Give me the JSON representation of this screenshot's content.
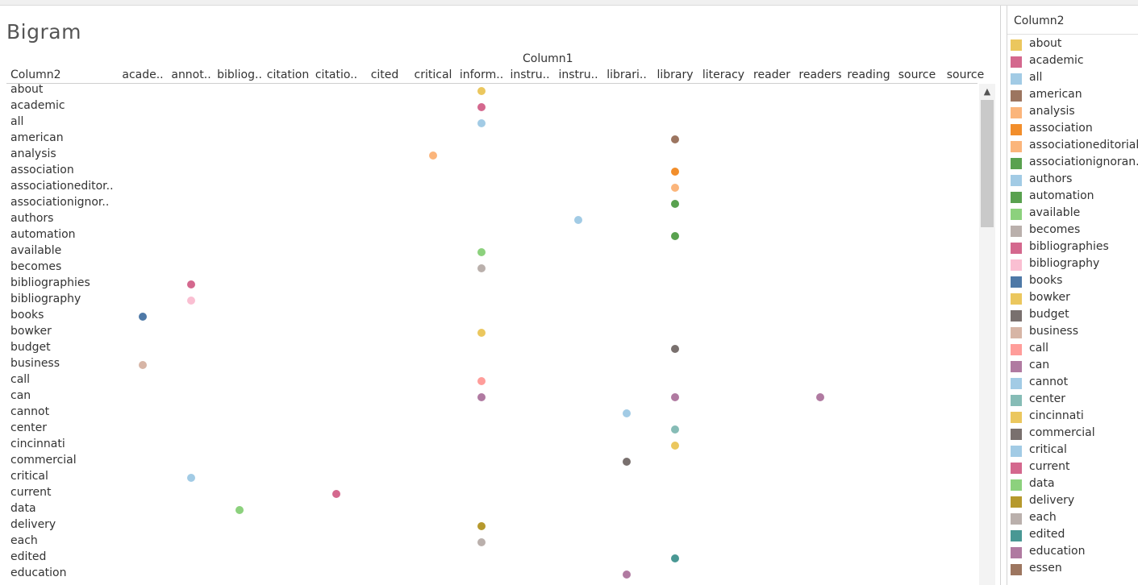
{
  "title": "Bigram",
  "legend": {
    "title": "Column2",
    "items": [
      {
        "label": "about",
        "color": "#ebc75e"
      },
      {
        "label": "academic",
        "color": "#d4688e"
      },
      {
        "label": "all",
        "color": "#a2cbe5"
      },
      {
        "label": "american",
        "color": "#9c7560"
      },
      {
        "label": "analysis",
        "color": "#fbb57b"
      },
      {
        "label": "association",
        "color": "#f28e2b"
      },
      {
        "label": "associationeditorial",
        "color": "#fbb57b"
      },
      {
        "label": "associationignoran..",
        "color": "#59a14f"
      },
      {
        "label": "authors",
        "color": "#a2cbe5"
      },
      {
        "label": "automation",
        "color": "#59a14f"
      },
      {
        "label": "available",
        "color": "#8cd17d"
      },
      {
        "label": "becomes",
        "color": "#bab0ac"
      },
      {
        "label": "bibliographies",
        "color": "#d4688e"
      },
      {
        "label": "bibliography",
        "color": "#fabfd2"
      },
      {
        "label": "books",
        "color": "#4e79a7"
      },
      {
        "label": "bowker",
        "color": "#ebc75e"
      },
      {
        "label": "budget",
        "color": "#79706e"
      },
      {
        "label": "business",
        "color": "#d7b5a6"
      },
      {
        "label": "call",
        "color": "#ff9d9a"
      },
      {
        "label": "can",
        "color": "#b07aa1"
      },
      {
        "label": "cannot",
        "color": "#a2cbe5"
      },
      {
        "label": "center",
        "color": "#86bcb6"
      },
      {
        "label": "cincinnati",
        "color": "#ebc75e"
      },
      {
        "label": "commercial",
        "color": "#79706e"
      },
      {
        "label": "critical",
        "color": "#a2cbe5"
      },
      {
        "label": "current",
        "color": "#d4688e"
      },
      {
        "label": "data",
        "color": "#8cd17d"
      },
      {
        "label": "delivery",
        "color": "#b6992d"
      },
      {
        "label": "each",
        "color": "#bab0ac"
      },
      {
        "label": "edited",
        "color": "#499894"
      },
      {
        "label": "education",
        "color": "#b07aa1"
      },
      {
        "label": "essen",
        "color": "#9d7660"
      }
    ]
  },
  "chart_data": {
    "type": "scatter",
    "title": "Bigram",
    "x_field": "Column1",
    "y_field": "Column2",
    "columns": [
      "acade..",
      "annot..",
      "bibliog..",
      "citation",
      "citatio..",
      "cited",
      "critical",
      "inform..",
      "instru..",
      "instru..",
      "librari..",
      "library",
      "literacy",
      "reader",
      "readers",
      "reading",
      "source",
      "source"
    ],
    "rows": [
      "about",
      "academic",
      "all",
      "american",
      "analysis",
      "association",
      "associationeditor..",
      "associationignor..",
      "authors",
      "automation",
      "available",
      "becomes",
      "bibliographies",
      "bibliography",
      "books",
      "bowker",
      "budget",
      "business",
      "call",
      "can",
      "cannot",
      "center",
      "cincinnati",
      "commercial",
      "critical",
      "current",
      "data",
      "delivery",
      "each",
      "edited",
      "education"
    ],
    "points": [
      {
        "row": "about",
        "col": 7,
        "color": "#ebc75e"
      },
      {
        "row": "academic",
        "col": 7,
        "color": "#d4688e"
      },
      {
        "row": "all",
        "col": 7,
        "color": "#a2cbe5"
      },
      {
        "row": "american",
        "col": 11,
        "color": "#9c7560"
      },
      {
        "row": "analysis",
        "col": 6,
        "color": "#fbb57b"
      },
      {
        "row": "association",
        "col": 11,
        "color": "#f28e2b"
      },
      {
        "row": "associationeditor..",
        "col": 11,
        "color": "#fbb57b"
      },
      {
        "row": "associationignor..",
        "col": 11,
        "color": "#59a14f"
      },
      {
        "row": "authors",
        "col": 9,
        "color": "#a2cbe5"
      },
      {
        "row": "automation",
        "col": 11,
        "color": "#59a14f"
      },
      {
        "row": "available",
        "col": 7,
        "color": "#8cd17d"
      },
      {
        "row": "becomes",
        "col": 7,
        "color": "#bab0ac"
      },
      {
        "row": "bibliographies",
        "col": 1,
        "color": "#d4688e"
      },
      {
        "row": "bibliography",
        "col": 1,
        "color": "#fabfd2"
      },
      {
        "row": "books",
        "col": 0,
        "color": "#4e79a7"
      },
      {
        "row": "bowker",
        "col": 7,
        "color": "#ebc75e"
      },
      {
        "row": "budget",
        "col": 11,
        "color": "#79706e"
      },
      {
        "row": "business",
        "col": 0,
        "color": "#d7b5a6"
      },
      {
        "row": "call",
        "col": 7,
        "color": "#ff9d9a"
      },
      {
        "row": "can",
        "col": 7,
        "color": "#b07aa1"
      },
      {
        "row": "can",
        "col": 11,
        "color": "#b07aa1"
      },
      {
        "row": "can",
        "col": 14,
        "color": "#b07aa1"
      },
      {
        "row": "cannot",
        "col": 10,
        "color": "#a2cbe5"
      },
      {
        "row": "center",
        "col": 11,
        "color": "#86bcb6"
      },
      {
        "row": "cincinnati",
        "col": 11,
        "color": "#ebc75e"
      },
      {
        "row": "commercial",
        "col": 10,
        "color": "#79706e"
      },
      {
        "row": "critical",
        "col": 1,
        "color": "#a2cbe5"
      },
      {
        "row": "current",
        "col": 4,
        "color": "#d4688e"
      },
      {
        "row": "data",
        "col": 2,
        "color": "#8cd17d"
      },
      {
        "row": "delivery",
        "col": 7,
        "color": "#b6992d"
      },
      {
        "row": "each",
        "col": 7,
        "color": "#bab0ac"
      },
      {
        "row": "edited",
        "col": 11,
        "color": "#499894"
      },
      {
        "row": "education",
        "col": 10,
        "color": "#b07aa1"
      }
    ]
  }
}
